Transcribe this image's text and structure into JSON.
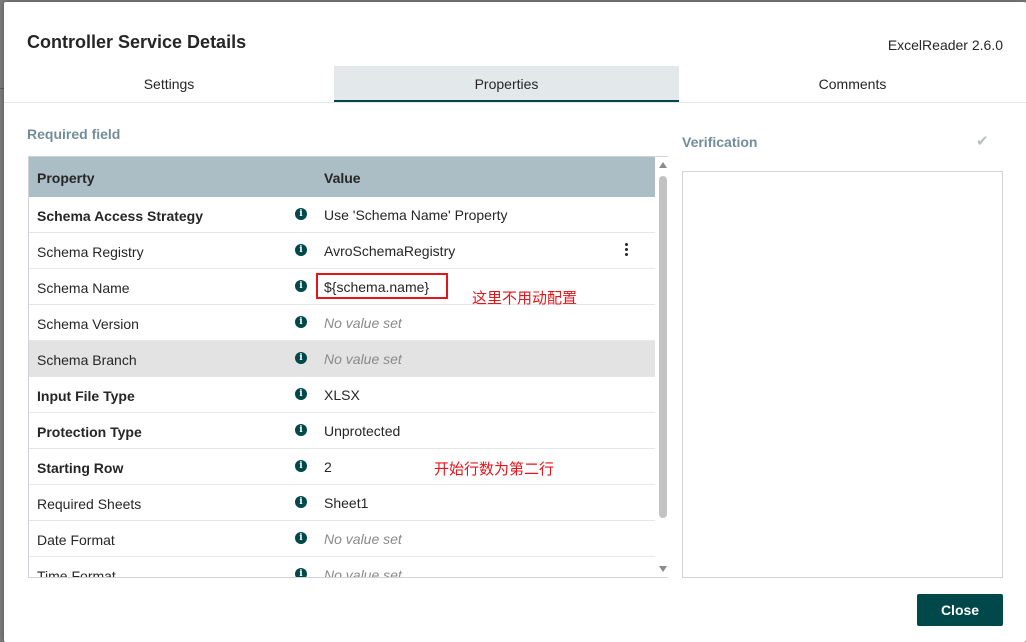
{
  "dialog": {
    "title": "Controller Service Details",
    "version": "ExcelReader 2.6.0"
  },
  "tabs": [
    {
      "label": "Settings",
      "active": false
    },
    {
      "label": "Properties",
      "active": true
    },
    {
      "label": "Comments",
      "active": false
    }
  ],
  "required_field_label": "Required field",
  "grid": {
    "header_property": "Property",
    "header_value": "Value",
    "rows": [
      {
        "name": "Schema Access Strategy",
        "required": true,
        "value": "Use 'Schema Name' Property",
        "unset": false
      },
      {
        "name": "Schema Registry",
        "required": false,
        "value": "AvroSchemaRegistry",
        "unset": false
      },
      {
        "name": "Schema Name",
        "required": false,
        "value": "${schema.name}",
        "unset": false
      },
      {
        "name": "Schema Version",
        "required": false,
        "value": "No value set",
        "unset": true
      },
      {
        "name": "Schema Branch",
        "required": false,
        "value": "No value set",
        "unset": true
      },
      {
        "name": "Input File Type",
        "required": true,
        "value": "XLSX",
        "unset": false
      },
      {
        "name": "Protection Type",
        "required": true,
        "value": "Unprotected",
        "unset": false
      },
      {
        "name": "Starting Row",
        "required": true,
        "value": "2",
        "unset": false
      },
      {
        "name": "Required Sheets",
        "required": false,
        "value": "Sheet1",
        "unset": false
      },
      {
        "name": "Date Format",
        "required": false,
        "value": "No value set",
        "unset": true
      },
      {
        "name": "Time Format",
        "required": false,
        "value": "No value set",
        "unset": true
      }
    ]
  },
  "annotations": {
    "schema_name_note": "这里不用动配置",
    "starting_row_note": "开始行数为第二行"
  },
  "verification": {
    "label": "Verification"
  },
  "buttons": {
    "close": "Close"
  },
  "colors": {
    "accent": "#004849",
    "header_bg": "#abbdc5",
    "annotation_red": "#e4151b"
  }
}
